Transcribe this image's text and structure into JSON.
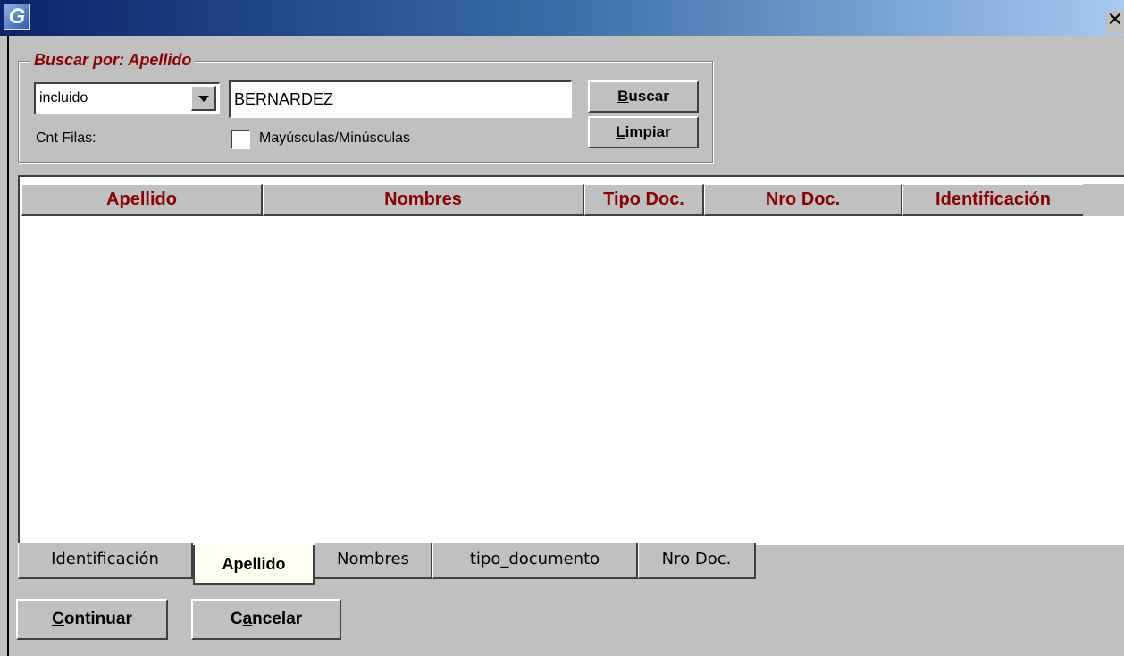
{
  "window": {
    "app_icon_letter": "G",
    "close_glyph": "✕"
  },
  "search": {
    "group_title": "Buscar por: Apellido",
    "match_mode": "incluido",
    "query": "BERNARDEZ",
    "buscar_label": "Buscar",
    "limpiar_label": "Limpiar",
    "cnt_filas_label": "Cnt Filas:",
    "case_checkbox_label": "Mayúsculas/Minúsculas",
    "case_checked": false
  },
  "grid": {
    "columns": [
      "Apellido",
      "Nombres",
      "Tipo Doc.",
      "Nro Doc.",
      "Identificación"
    ],
    "rows": []
  },
  "tabs": {
    "items": [
      "Identificación",
      "Apellido",
      "Nombres",
      "tipo_documento",
      "Nro Doc."
    ],
    "active": "Apellido"
  },
  "footer": {
    "continuar_label": "Continuar",
    "cancelar_label": "Cancelar"
  },
  "colors": {
    "accent_text": "#8b0000",
    "title_bar_start": "#0a246a",
    "title_bar_end": "#a6caf0"
  }
}
